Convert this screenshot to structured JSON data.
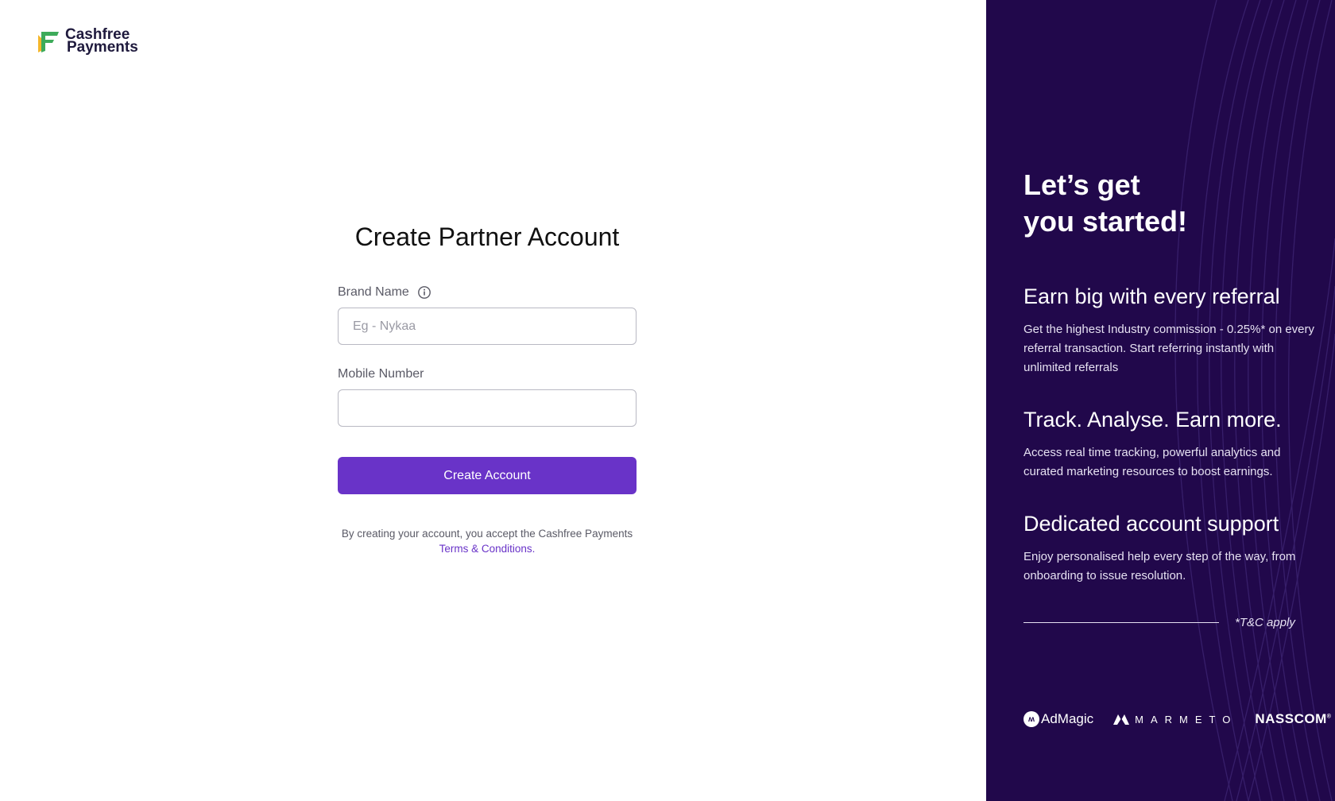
{
  "logo": {
    "line1": "Cashfree",
    "line2": "Payments"
  },
  "form": {
    "title": "Create Partner Account",
    "brand_label": "Brand Name",
    "brand_placeholder": "Eg - Nykaa",
    "brand_value": "",
    "mobile_label": "Mobile Number",
    "mobile_placeholder": "",
    "mobile_value": "",
    "submit_label": "Create Account",
    "terms_text": "By creating your account, you accept the Cashfree Payments",
    "terms_link": "Terms & Conditions."
  },
  "panel": {
    "headline_1": "Let’s get",
    "headline_2": "you started!",
    "features": [
      {
        "title": "Earn big with every referral",
        "desc": "Get the highest Industry commission - 0.25%* on every referral transaction. Start referring instantly with unlimited referrals"
      },
      {
        "title": "Track. Analyse. Earn more.",
        "desc": "Access real time tracking, powerful analytics and curated marketing resources to boost earnings."
      },
      {
        "title": "Dedicated account support",
        "desc": "Enjoy personalised help every step of the way, from onboarding to issue resolution."
      }
    ],
    "tc_note": "*T&C apply",
    "partners": [
      "AdMagic",
      "MARMETO",
      "NASSCOM"
    ]
  },
  "colors": {
    "accent": "#6933c8",
    "panel_bg": "#21084b",
    "logo_green": "#3dab5a",
    "logo_yellow": "#f5b62a"
  }
}
